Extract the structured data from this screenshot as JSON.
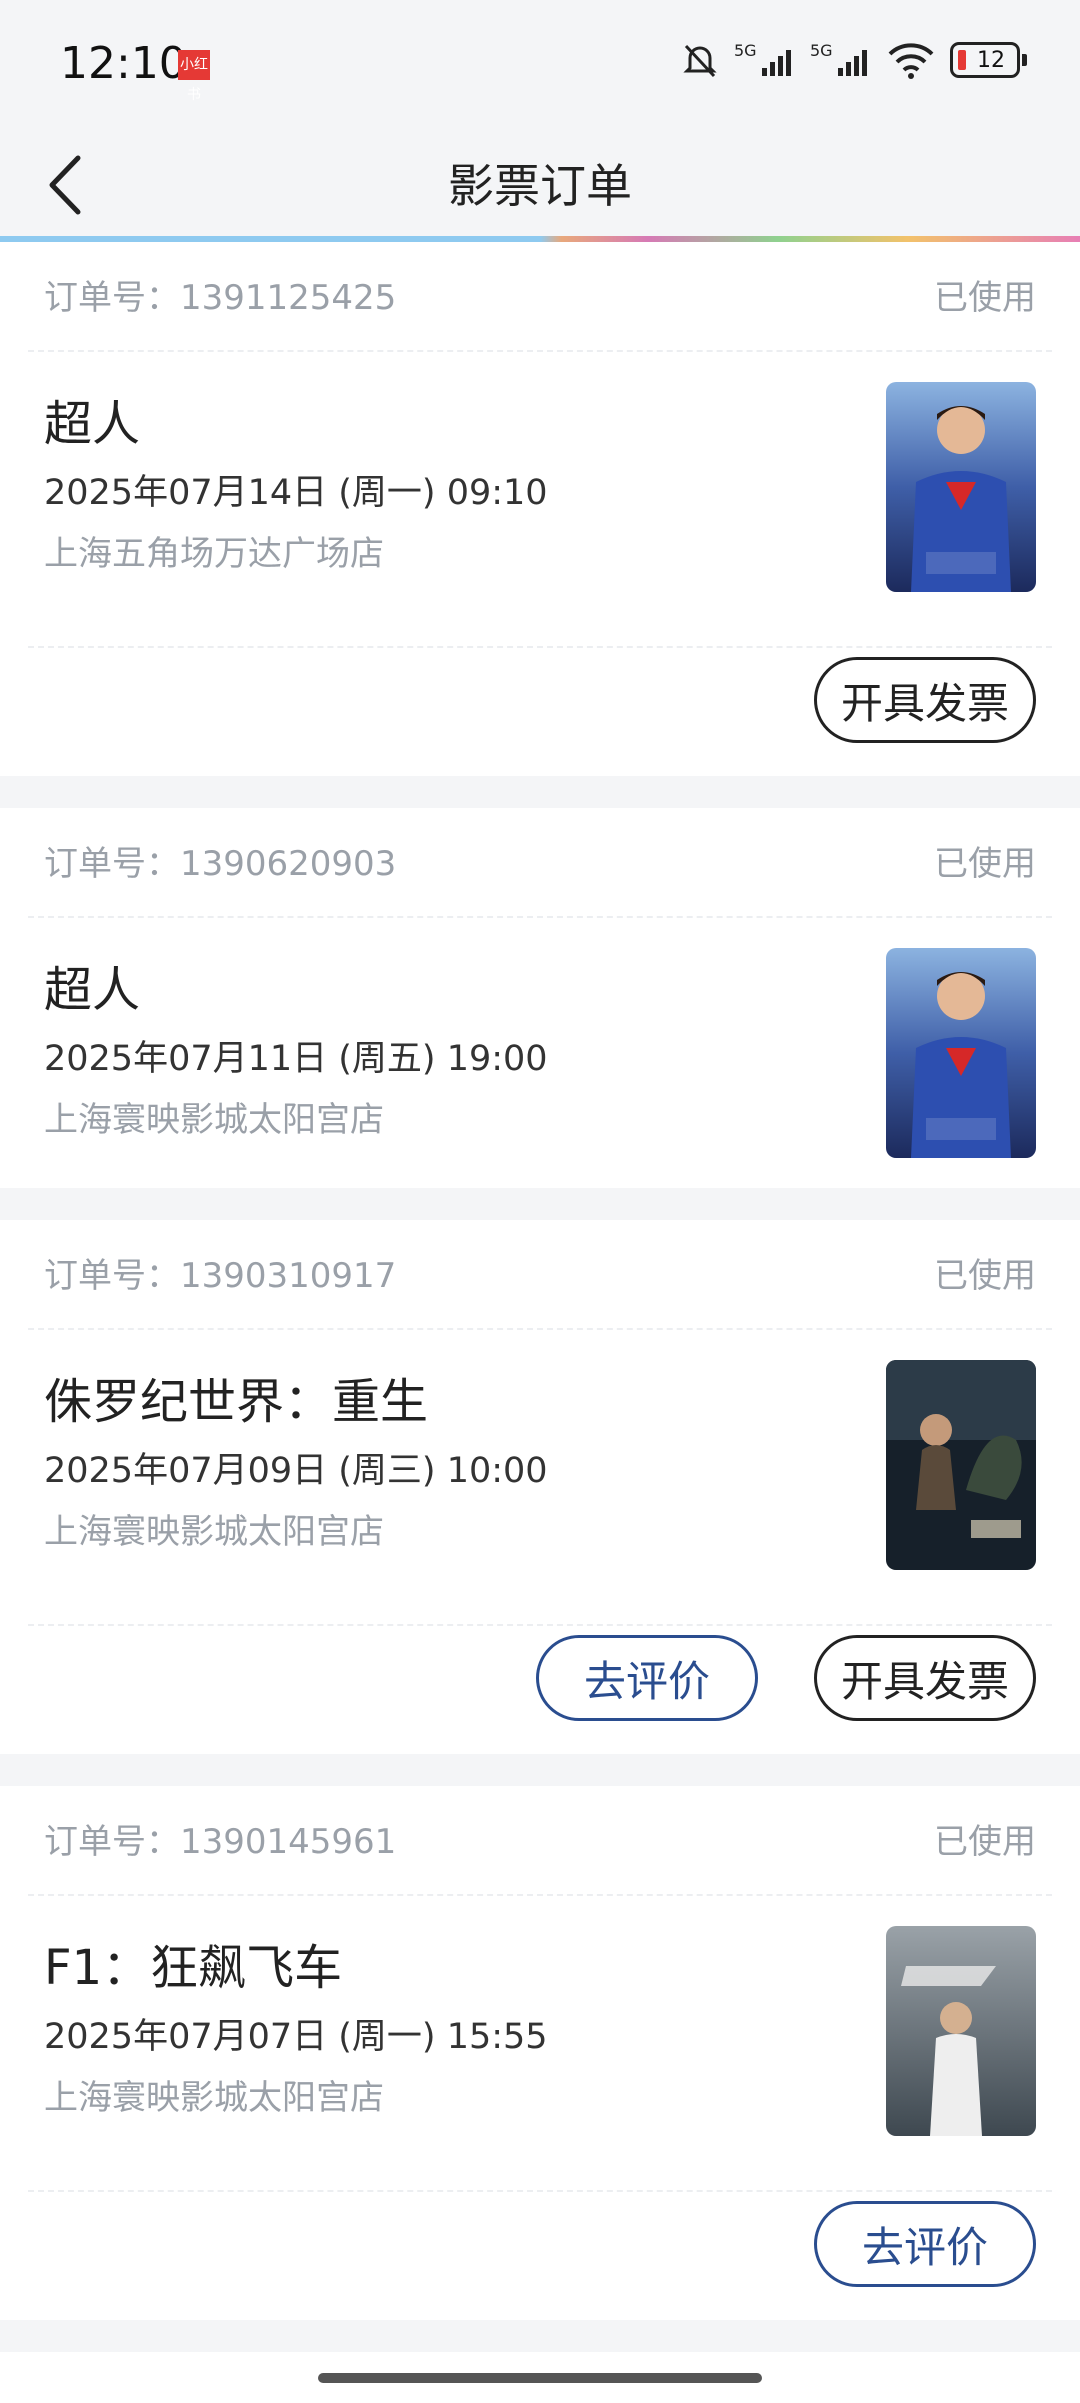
{
  "status_bar": {
    "time": "12:10",
    "app_badge": "小红书",
    "battery": "12"
  },
  "nav": {
    "title": "影票订单"
  },
  "orders": [
    {
      "order_label": "订单号：1391125425",
      "status": "已使用",
      "title": "超人",
      "showtime": "2025年07月14日 (周一) 09:10",
      "cinema": "上海五角场万达广场店",
      "invoice": "开具发票"
    },
    {
      "order_label": "订单号：1390620903",
      "status": "已使用",
      "title": "超人",
      "showtime": "2025年07月11日 (周五) 19:00",
      "cinema": "上海寰映影城太阳宫店"
    },
    {
      "order_label": "订单号：1390310917",
      "status": "已使用",
      "title": "侏罗纪世界：重生",
      "showtime": "2025年07月09日 (周三) 10:00",
      "cinema": "上海寰映影城太阳宫店",
      "review": "去评价",
      "invoice": "开具发票"
    },
    {
      "order_label": "订单号：1390145961",
      "status": "已使用",
      "title": "F1：狂飙飞车",
      "showtime": "2025年07月07日 (周一) 15:55",
      "cinema": "上海寰映影城太阳宫店",
      "review": "去评价"
    }
  ]
}
